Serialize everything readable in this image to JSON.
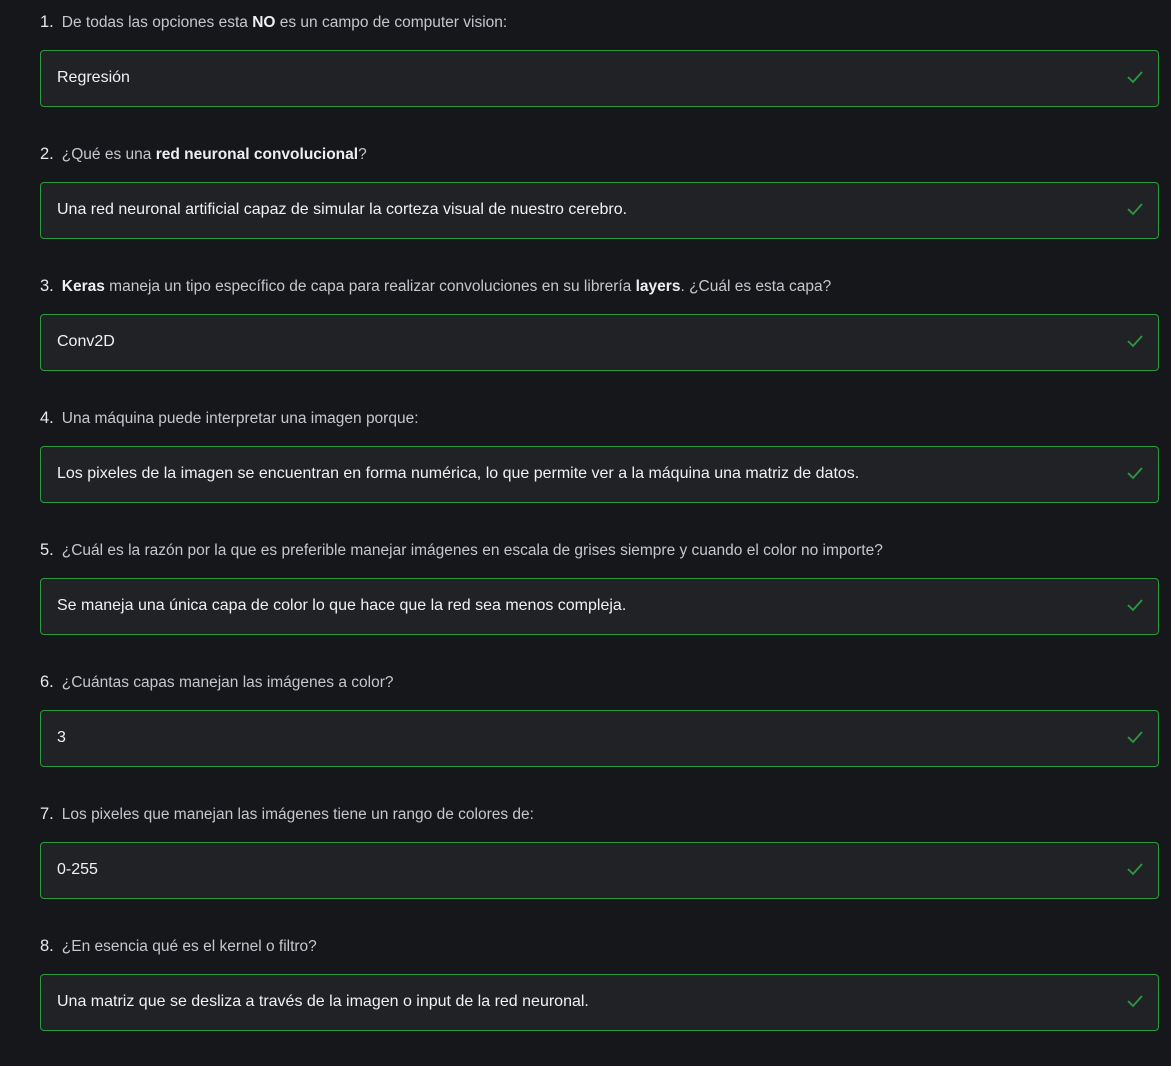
{
  "accent_color": "#2d9a42",
  "questions": [
    {
      "number": "1.",
      "parts": [
        "De todas las opciones esta ",
        "NO",
        " es un campo de computer vision:"
      ],
      "answer": "Regresión",
      "status_icon": "check-icon"
    },
    {
      "number": "2.",
      "parts": [
        "¿Qué es una ",
        "red neuronal convolucional",
        "?"
      ],
      "answer": "Una red neuronal artificial capaz de simular la corteza visual de nuestro cerebro.",
      "status_icon": "check-icon"
    },
    {
      "number": "3.",
      "parts": [
        "",
        "Keras",
        " maneja un tipo específico de capa para realizar convoluciones en su librería ",
        "layers",
        ". ¿Cuál es esta capa?"
      ],
      "answer": "Conv2D",
      "status_icon": "check-icon"
    },
    {
      "number": "4.",
      "parts": [
        "Una máquina puede interpretar una imagen porque:"
      ],
      "answer": "Los pixeles de la imagen se encuentran en forma numérica, lo que permite ver a la máquina una matriz de datos.",
      "status_icon": "check-icon"
    },
    {
      "number": "5.",
      "parts": [
        "¿Cuál es la razón por la que es preferible manejar imágenes en escala de grises siempre y cuando el color no importe?"
      ],
      "answer": "Se maneja una única capa de color lo que hace que la red sea menos compleja.",
      "status_icon": "check-icon"
    },
    {
      "number": "6.",
      "parts": [
        "¿Cuántas capas manejan las imágenes a color?"
      ],
      "answer": "3",
      "status_icon": "check-icon"
    },
    {
      "number": "7.",
      "parts": [
        "Los pixeles que manejan las imágenes tiene un rango de colores de:"
      ],
      "answer": "0-255",
      "status_icon": "check-icon"
    },
    {
      "number": "8.",
      "parts": [
        "¿En esencia qué es el kernel o filtro?"
      ],
      "answer": "Una matriz que se desliza a través de la imagen o input de la red neuronal.",
      "status_icon": "check-icon"
    }
  ]
}
